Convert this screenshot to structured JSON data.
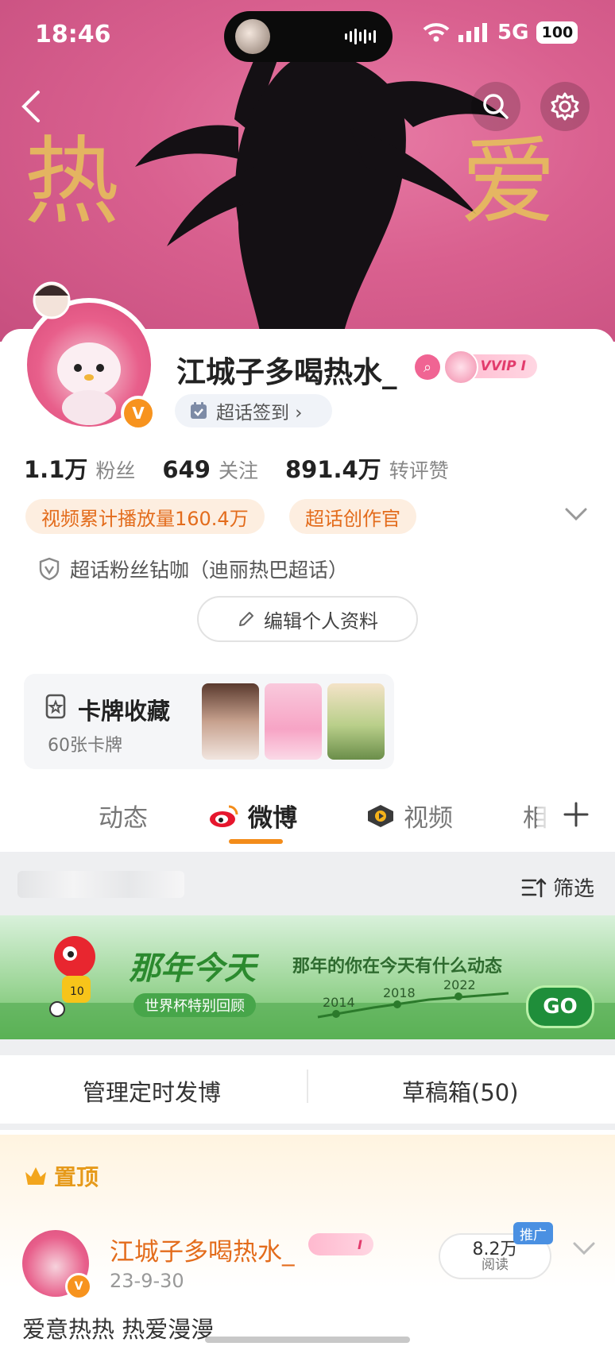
{
  "status_bar": {
    "time": "18:46",
    "network": "5G",
    "battery": "100"
  },
  "banner": {
    "art_text_left": "热",
    "art_text_right": "爱"
  },
  "profile": {
    "name": "江城子多喝热水_",
    "vip_badge": "VVIP I",
    "checkin_label": "超话签到 ›",
    "stats": [
      {
        "num": "1.1万",
        "label": "粉丝"
      },
      {
        "num": "649",
        "label": "关注"
      },
      {
        "num": "891.4万",
        "label": "转评赞"
      }
    ],
    "tags": [
      "视频累计播放量160.4万",
      "超话创作官"
    ],
    "fan_title": "超话粉丝钻咖（迪丽热巴超话）",
    "edit_label": "编辑个人资料"
  },
  "card_collection": {
    "title": "卡牌收藏",
    "count": "60张卡牌"
  },
  "tabs": [
    {
      "label": "动态"
    },
    {
      "label": "微博"
    },
    {
      "label": "视频"
    },
    {
      "label": "相"
    }
  ],
  "filter_label": "筛选",
  "promo": {
    "title": "那年今天",
    "subtitle": "那年的你在今天有什么动态",
    "tag": "世界杯特别回顾",
    "years": [
      "2014",
      "2018",
      "2022"
    ],
    "go": "GO"
  },
  "manage": {
    "left": "管理定时发博",
    "right": "草稿箱(50)"
  },
  "pinned": {
    "label": "置顶",
    "name": "江城子多喝热水_",
    "badge": "I",
    "date": "23-9-30",
    "reads_num": "8.2万",
    "reads_label": "阅读",
    "promote": "推广",
    "text": "爱意热热 热爱漫漫"
  },
  "colors": {
    "accent": "#f38c1a",
    "orange_text": "#e36c1c",
    "brand_green": "#2b8a2e"
  }
}
